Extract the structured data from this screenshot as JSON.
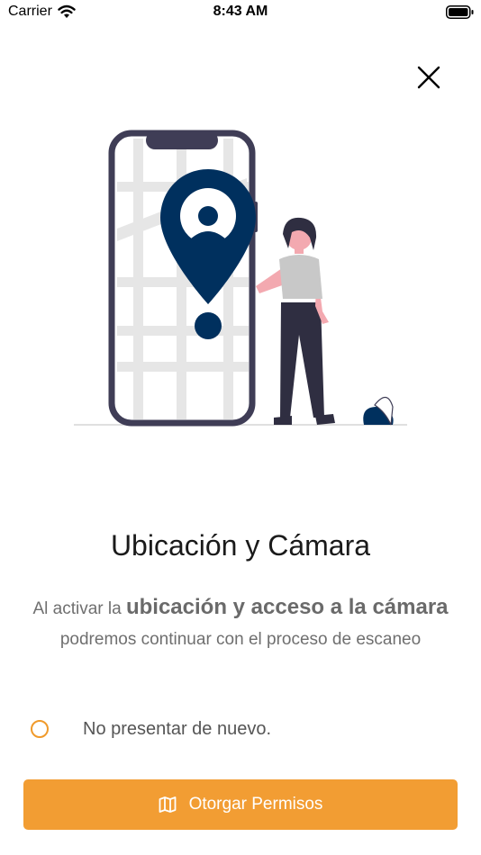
{
  "status_bar": {
    "carrier": "Carrier",
    "time": "8:43 AM",
    "icons": [
      "wifi-icon",
      "battery-icon"
    ]
  },
  "header": {
    "close_icon": "close-icon"
  },
  "illustration": {
    "description_icon": "phone-map-location-pin-person-illustration",
    "colors": {
      "phone_frame": "#3f3d56",
      "pin": "#00305e",
      "map_streets": "#e6e6e6",
      "skin": "#f3a9b0",
      "shirt": "#c8c8c8",
      "pants": "#2f2e41"
    }
  },
  "content": {
    "title": "Ubicación y Cámara",
    "description_prefix": "Al activar la ",
    "description_bold": "ubicación y acceso a la cámara",
    "description_suffix": " podremos continuar con el proceso de escaneo"
  },
  "options": {
    "dont_show_label": "No presentar de nuevo.",
    "dont_show_checked": false
  },
  "actions": {
    "grant_label": "Otorgar Permisos",
    "grant_icon": "map-icon"
  },
  "colors": {
    "accent": "#f29d33",
    "radio_border": "#f09a2b",
    "title_text": "#1a1a1a",
    "body_text": "#6f6f6f"
  }
}
